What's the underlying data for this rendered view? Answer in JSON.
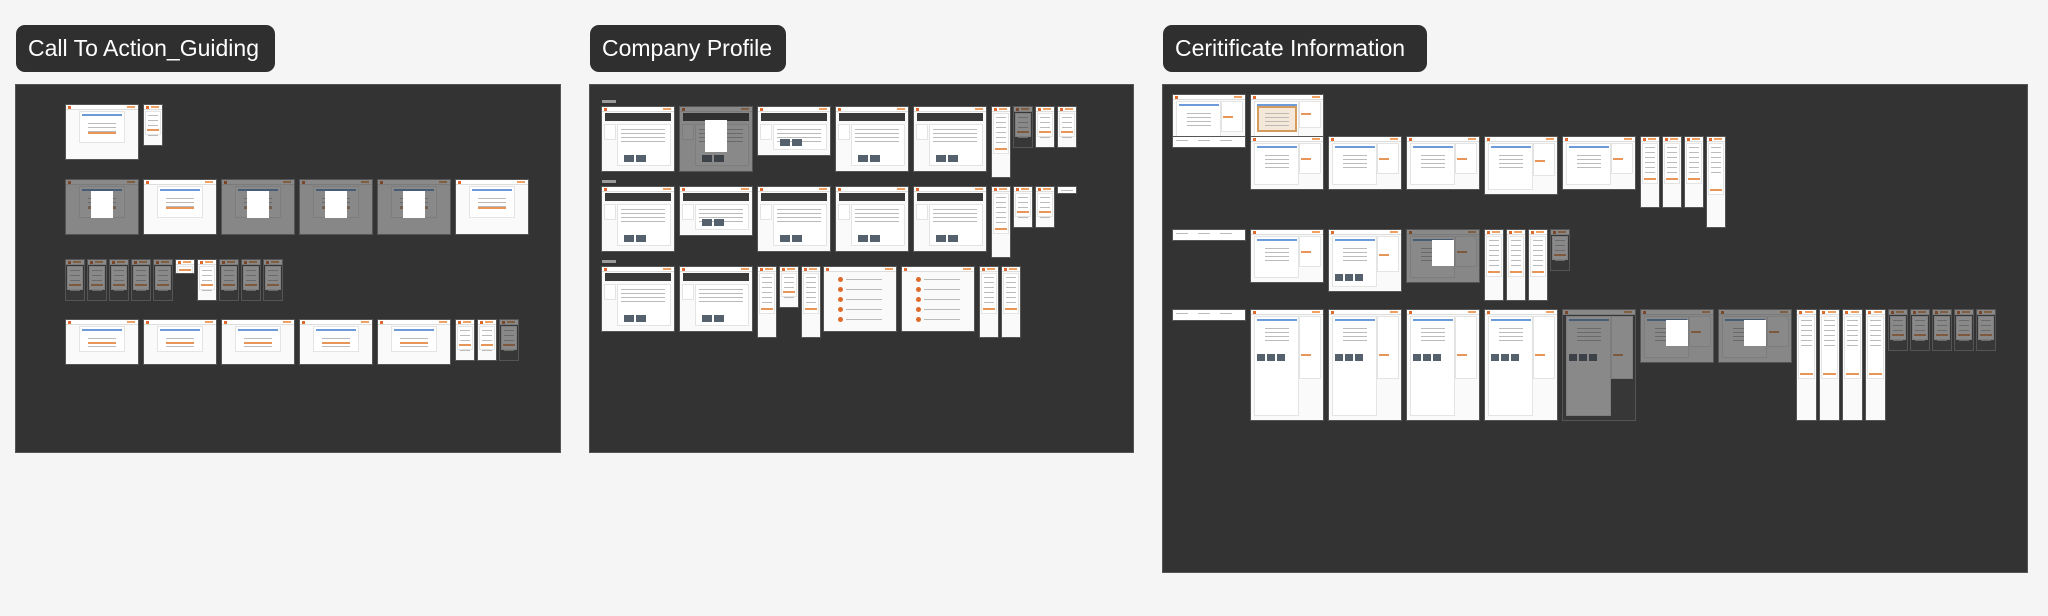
{
  "canvas": {
    "background": "#f4f5f4",
    "board_color": "#333333",
    "accent": "#e8955a",
    "brand": "#e06a2a",
    "link_blue": "#6b9bd8"
  },
  "sections": [
    {
      "id": "call-to-action",
      "title": "Call To Action_Guiding",
      "rows": [
        {
          "label_lines": 3,
          "frames": [
            "desktop",
            "mobile"
          ]
        },
        {
          "label_lines": 4,
          "frames": [
            "desktop-modal",
            "desktop-dropdown",
            "desktop-modal",
            "desktop-modal",
            "desktop-modal",
            "desktop"
          ]
        },
        {
          "label_lines": 0,
          "frames": [
            "mobile-dim",
            "mobile-dim",
            "mobile-dim",
            "mobile-dim",
            "mobile-dim",
            "mobile-small",
            "mobile",
            "mobile-dim",
            "mobile-dim",
            "mobile-dim"
          ]
        },
        {
          "label_lines": 2,
          "frames": [
            "desktop-split",
            "desktop-split",
            "desktop-empty",
            "desktop-split",
            "desktop-split",
            "mobile",
            "mobile",
            "mobile-dim"
          ]
        }
      ]
    },
    {
      "id": "company-profile",
      "title": "Company Profile",
      "rows": [
        {
          "frames": [
            "profile",
            "profile-modal",
            "profile-short",
            "profile-tall",
            "profile-tall",
            "mobile-tall",
            "mobile-dim",
            "mobile",
            "mobile"
          ]
        },
        {
          "frames": [
            "profile",
            "profile-short",
            "profile-tall",
            "profile-tall",
            "profile-tall",
            "mobile-tall",
            "mobile",
            "mobile",
            "note"
          ]
        },
        {
          "frames": [
            "profile",
            "profile",
            "mobile-tall",
            "mobile",
            "mobile-tall",
            "list",
            "list",
            "mobile-tall",
            "mobile-tall"
          ]
        }
      ]
    },
    {
      "id": "certificate-information",
      "title": "Ceritificate Information",
      "rows": [
        {
          "frames": [
            "cert",
            "cert-document"
          ]
        },
        {
          "frames": [
            "table-note",
            "cert",
            "cert",
            "cert",
            "cert-tall",
            "cert",
            "mobile-tall",
            "mobile-tall",
            "mobile-tall",
            "mobile-cert"
          ]
        },
        {
          "frames": [
            "table-note",
            "cert",
            "cert-photos",
            "cert-modal",
            "mobile-tall",
            "mobile-tall",
            "mobile-tall",
            "mobile-dim"
          ]
        },
        {
          "frames": [
            "table-note",
            "cert-long",
            "cert-long",
            "cert-long",
            "cert-long",
            "cert-long-dim",
            "cert-modal",
            "cert-modal",
            "mobile-long",
            "mobile-long",
            "mobile-long",
            "mobile-long",
            "mobile-dim",
            "mobile-dim",
            "mobile-dim",
            "mobile-dim",
            "mobile-dim"
          ]
        }
      ]
    }
  ]
}
